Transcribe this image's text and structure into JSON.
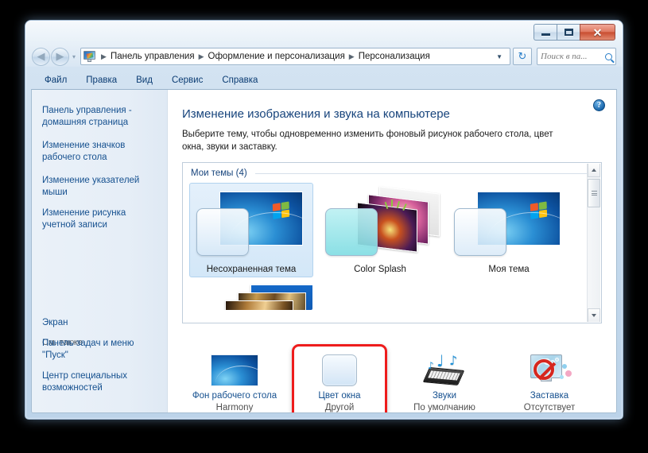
{
  "window": {
    "caption": {
      "minimize_label": "−",
      "maximize_label": "",
      "close_label": "✕"
    },
    "nav": {
      "back_glyph": "◀",
      "forward_glyph": "▶",
      "history_glyph": "▾",
      "breadcrumbs": [
        "Панель управления",
        "Оформление и персонализация",
        "Персонализация"
      ],
      "separator": "▶",
      "dropdown_glyph": "▼",
      "refresh_glyph": "↻",
      "search_placeholder": "Поиск в па..."
    },
    "menu": [
      {
        "label": "Файл",
        "accel": "Ф"
      },
      {
        "label": "Правка",
        "accel": "П"
      },
      {
        "label": "Вид",
        "accel": "В"
      },
      {
        "label": "Сервис",
        "accel": "е"
      },
      {
        "label": "Справка",
        "accel": "С"
      }
    ]
  },
  "sidebar": {
    "items": [
      {
        "label": "Панель управления - домашняя страница"
      },
      {
        "label": "Изменение значков рабочего стола"
      },
      {
        "label": "Изменение указателей мыши"
      },
      {
        "label": "Изменение рисунка учетной записи"
      }
    ],
    "see_also_title": "См. также",
    "see_also": [
      {
        "label": "Экран"
      },
      {
        "label": "Панель задач и меню \"Пуск\""
      },
      {
        "label": "Центр специальных возможностей"
      }
    ]
  },
  "main": {
    "help_label": "?",
    "title": "Изменение изображения и звука на компьютере",
    "description": "Выберите тему, чтобы одновременно изменить фоновый рисунок рабочего стола, цвет окна, звуки и заставку.",
    "gallery": {
      "group_title": "Мои темы (4)",
      "themes": [
        {
          "label": "Несохраненная тема",
          "selected": true,
          "art": "win7"
        },
        {
          "label": "Color Splash",
          "selected": false,
          "art": "splash"
        },
        {
          "label": "Моя тема",
          "selected": false,
          "art": "win7"
        },
        {
          "label": "",
          "selected": false,
          "art": "landscape"
        }
      ],
      "scrollbar": {
        "up_glyph": "▲",
        "down_glyph": "▼"
      }
    },
    "options": [
      {
        "title": "Фон рабочего стола",
        "value": "Harmony",
        "icon": "wallpaper-icon",
        "highlighted": false
      },
      {
        "title": "Цвет окна",
        "value": "Другой",
        "icon": "window-color-icon",
        "highlighted": true
      },
      {
        "title": "Звуки",
        "value": "По умолчанию",
        "icon": "sounds-icon",
        "highlighted": false
      },
      {
        "title": "Заставка",
        "value": "Отсутствует",
        "icon": "screensaver-icon",
        "highlighted": false
      }
    ]
  },
  "colors": {
    "accent_link": "#15508f",
    "title_blue": "#17447c",
    "highlight_red": "#ee1c1c",
    "close_button_red": "#c94e32"
  }
}
